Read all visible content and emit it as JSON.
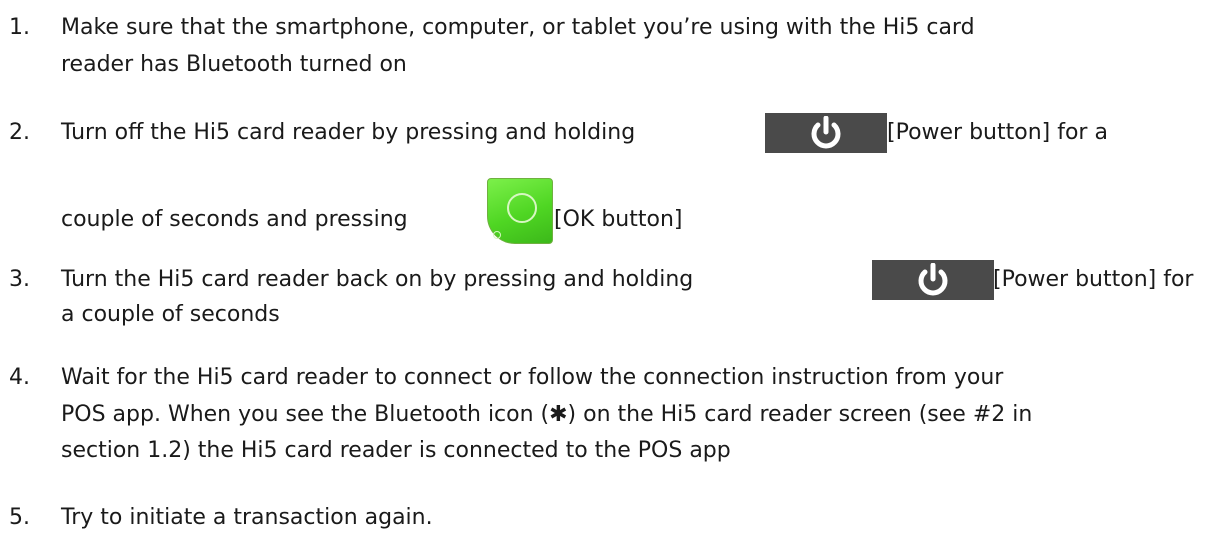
{
  "steps": [
    {
      "number": "1.",
      "line1": "Make sure that the smartphone, computer, or tablet you’re using with the Hi5 card",
      "line2": "reader has Bluetooth turned on"
    },
    {
      "number": "2.",
      "line1_before": "Turn off the Hi5 card reader by pressing and holding",
      "line1_after": "[Power button] for a",
      "line2_before": "couple of seconds and pressing",
      "line2_after": "[OK button]"
    },
    {
      "number": "3.",
      "line1_before": "Turn the Hi5 card reader back on by pressing and holding",
      "line1_after": "[Power button] for",
      "line2": "a couple of seconds"
    },
    {
      "number": "4.",
      "line1": "Wait for the Hi5 card reader to connect or follow the connection instruction from your",
      "line2": "POS app. When you see the Bluetooth icon (✱) on the Hi5 card reader screen (see #2 in",
      "line3": "section 1.2) the Hi5 card reader is connected to the POS app"
    },
    {
      "number": "5.",
      "line1": "Try to initiate a transaction again."
    }
  ],
  "icons": {
    "power": "power-icon",
    "ok": "ok-button-icon"
  },
  "colors": {
    "power_bg": "#4a4a4a",
    "power_symbol": "#ffffff",
    "ok_green": "#4fd623"
  }
}
